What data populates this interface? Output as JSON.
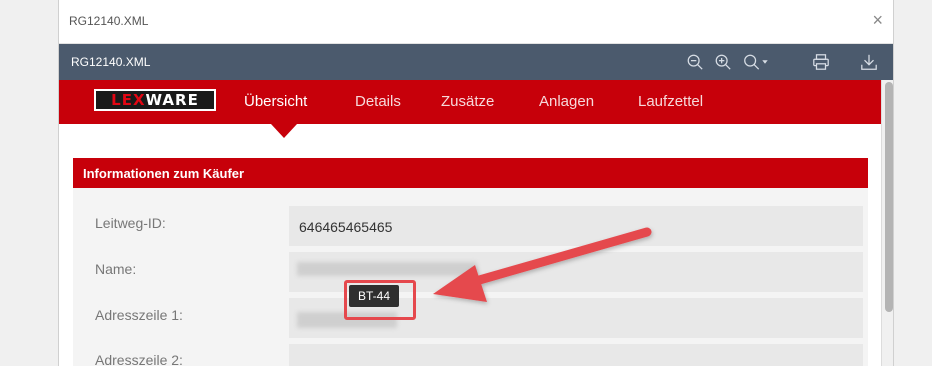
{
  "window": {
    "title": "RG12140.XML",
    "close_glyph": "×"
  },
  "toolbar": {
    "filename": "RG12140.XML",
    "icons": [
      "zoom-out-icon",
      "zoom-in-icon",
      "zoom-menu-icon",
      "print-icon",
      "download-icon"
    ]
  },
  "brand": {
    "logo_part1": "LEX",
    "logo_part2": "WARE",
    "color": "#c7000a"
  },
  "tabs": [
    {
      "label": "Übersicht",
      "active": true
    },
    {
      "label": "Details",
      "active": false
    },
    {
      "label": "Zusätze",
      "active": false
    },
    {
      "label": "Anlagen",
      "active": false
    },
    {
      "label": "Laufzettel",
      "active": false
    }
  ],
  "section": {
    "title": "Informationen zum Käufer",
    "rows": [
      {
        "label": "Leitweg-ID:",
        "value": "646465465465"
      },
      {
        "label": "Name:",
        "value": ""
      },
      {
        "label": "Adresszeile 1:",
        "value": ""
      },
      {
        "label": "Adresszeile 2:",
        "value": ""
      }
    ]
  },
  "tooltip": {
    "text": "BT-44"
  },
  "annotation_color": "#e5484d"
}
